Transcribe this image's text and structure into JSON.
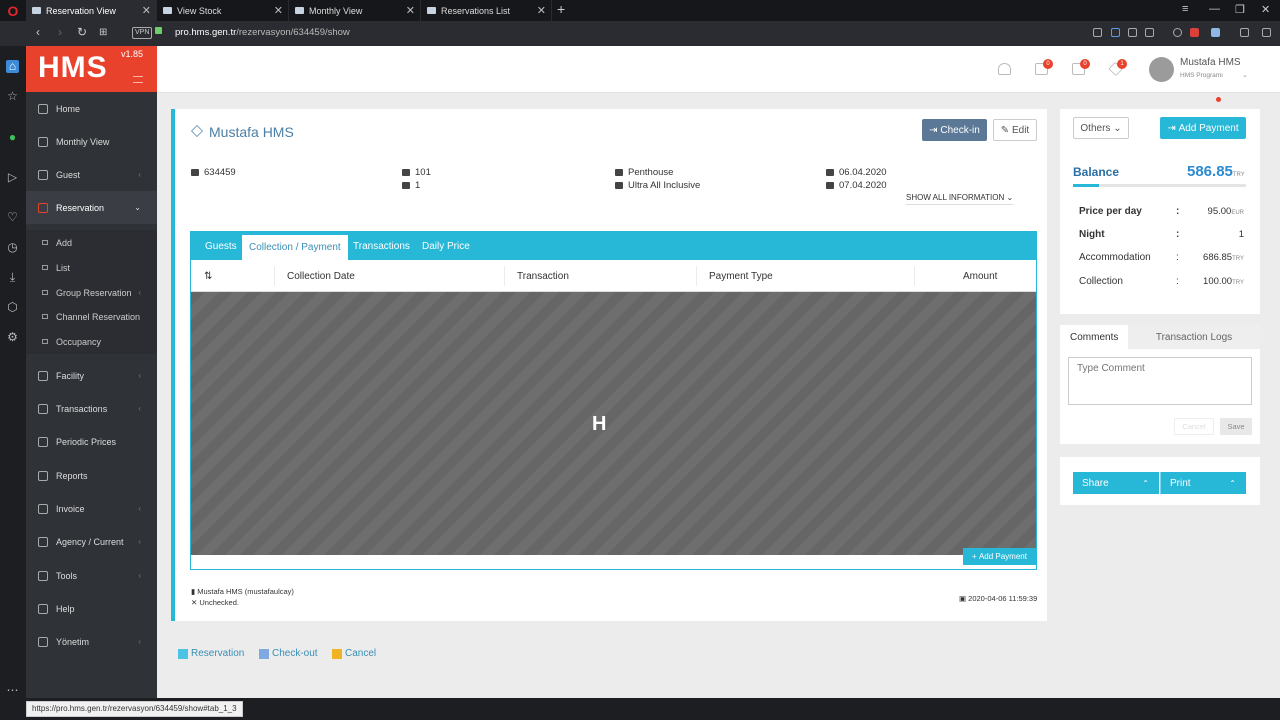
{
  "browser": {
    "tabs": [
      {
        "label": "Reservation View"
      },
      {
        "label": "View Stock"
      },
      {
        "label": "Monthly View"
      },
      {
        "label": "Reservations List"
      }
    ],
    "url_host": "pro.hms.gen.tr",
    "url_path": "/rezervasyon/634459/show",
    "vpn_label": "VPN",
    "status_url": "https://pro.hms.gen.tr/rezervasyon/634459/show#tab_1_3"
  },
  "app": {
    "logo_text": "HMS",
    "version": "v1.85",
    "accent": "#e8412c",
    "primary": "#27b7d7"
  },
  "sidebar": {
    "items": [
      {
        "label": "Home",
        "icon": "home-icon"
      },
      {
        "label": "Monthly View",
        "icon": "calendar-icon"
      },
      {
        "label": "Guest",
        "icon": "user-icon"
      },
      {
        "label": "Reservation",
        "icon": "bell-icon"
      },
      {
        "label": "Facility",
        "icon": "building-icon"
      },
      {
        "label": "Transactions",
        "icon": "diamond-icon"
      },
      {
        "label": "Periodic Prices",
        "icon": "tag-icon"
      },
      {
        "label": "Reports",
        "icon": "chart-icon"
      },
      {
        "label": "Invoice",
        "icon": "file-icon"
      },
      {
        "label": "Agency / Current",
        "icon": "scale-icon"
      },
      {
        "label": "Tools",
        "icon": "layers-icon"
      },
      {
        "label": "Help",
        "icon": "heart-icon"
      },
      {
        "label": "Yönetim",
        "icon": "settings-icon"
      }
    ],
    "sub_items": [
      {
        "label": "Add"
      },
      {
        "label": "List"
      },
      {
        "label": "Group Reservation"
      },
      {
        "label": "Channel Reservation"
      },
      {
        "label": "Occupancy"
      }
    ]
  },
  "topbar": {
    "cart_count": "0",
    "mail_count": "0",
    "flag_count": "1",
    "user_name": "Mustafa HMS",
    "user_role": "HMS Programı"
  },
  "reservation": {
    "guest_name": "Mustafa HMS",
    "checkin_label": "Check-in",
    "edit_label": "Edit",
    "id": "634459",
    "room": "101",
    "guests": "1",
    "room_type": "Penthouse",
    "board": "Ultra All Inclusive",
    "date_in": "06.04.2020",
    "date_out": "07.04.2020",
    "show_all": "SHOW ALL INFORMATION",
    "tabs": [
      {
        "label": "Guests"
      },
      {
        "label": "Collection / Payment"
      },
      {
        "label": "Transactions"
      },
      {
        "label": "Daily Price"
      }
    ],
    "columns": [
      "Collection Date",
      "Transaction",
      "Payment Type",
      "Amount"
    ],
    "loading_glyph": "H",
    "add_payment_small": "Add Payment",
    "created_by": "Mustafa HMS (mustafaulcay)",
    "check_status": "Unchecked.",
    "created_at": "2020-04-06 11:59:39"
  },
  "legend": [
    {
      "label": "Reservation",
      "color": "#4cc3e3"
    },
    {
      "label": "Check-out",
      "color": "#7fa9e0"
    },
    {
      "label": "Cancel",
      "color": "#f0b323"
    }
  ],
  "summary": {
    "others_label": "Others",
    "add_payment_label": "Add Payment",
    "balance_label": "Balance",
    "balance_value": "586.85",
    "balance_currency": "TRY",
    "rows": [
      {
        "label": "Price per day",
        "value": "95.00",
        "currency": "EUR"
      },
      {
        "label": "Night",
        "value": "1",
        "currency": ""
      },
      {
        "label": "Accommodation",
        "value": "686.85",
        "currency": "TRY"
      },
      {
        "label": "Collection",
        "value": "100.00",
        "currency": "TRY"
      }
    ]
  },
  "comments": {
    "tab_comments": "Comments",
    "tab_logs": "Transaction Logs",
    "placeholder": "Type Comment",
    "cancel_label": "Cancel",
    "save_label": "Save"
  },
  "actions": {
    "share_label": "Share",
    "print_label": "Print"
  }
}
